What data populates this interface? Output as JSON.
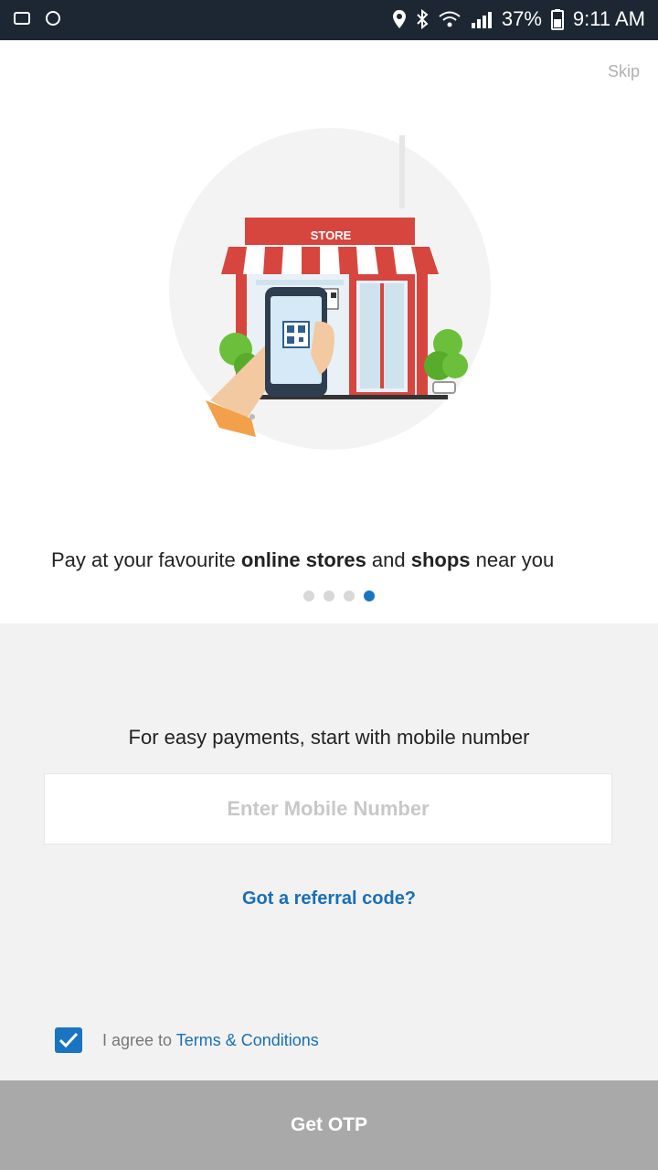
{
  "status_bar": {
    "battery": "37%",
    "time": "9:11 AM",
    "icons": [
      "location-icon",
      "bluetooth-icon",
      "wifi-icon",
      "signal-icon",
      "battery-icon"
    ]
  },
  "onboarding": {
    "skip_label": "Skip",
    "store_sign": "STORE",
    "tagline": {
      "part1": "Pay at your favourite ",
      "bold1": "online stores",
      "part2": " and ",
      "bold2": "shops",
      "part3": " near you"
    },
    "page_indicator": {
      "count": 4,
      "active_index": 3
    }
  },
  "login": {
    "prompt": "For easy payments, start with mobile number",
    "mobile_placeholder": "Enter Mobile Number",
    "mobile_value": "",
    "referral_label": "Got a referral code?",
    "terms_prefix": "I agree to ",
    "terms_link": "Terms & Conditions",
    "terms_checked": true,
    "otp_button": "Get OTP"
  },
  "colors": {
    "accent": "#1a74c2",
    "status_bar": "#1c2733",
    "button_disabled": "#a9a9a9",
    "panel": "#f2f2f2"
  }
}
